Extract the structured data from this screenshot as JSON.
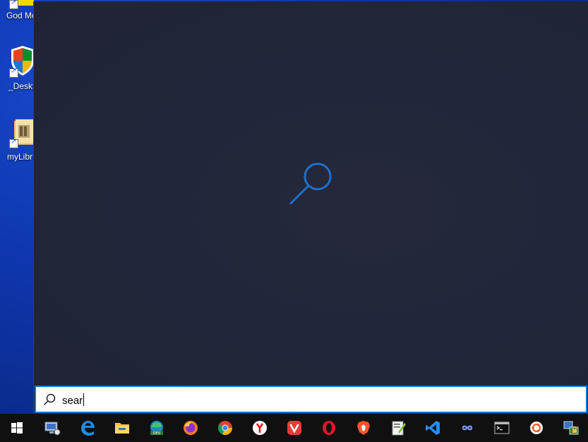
{
  "desktop": {
    "icons": [
      {
        "label": "God Mo",
        "name": "god-mode-shortcut"
      },
      {
        "label": "_Deskt",
        "name": "desktop-shortcut"
      },
      {
        "label": "myLibr",
        "name": "mylibrary-shortcut"
      }
    ]
  },
  "search": {
    "query": "sear",
    "panel_icon": "search-icon"
  },
  "taskbar": {
    "apps": [
      {
        "name": "start-button",
        "icon": "windows-logo-icon"
      },
      {
        "name": "this-pc-app",
        "icon": "computer-icon"
      },
      {
        "name": "edge-legacy-app",
        "icon": "edge-icon"
      },
      {
        "name": "file-explorer-app",
        "icon": "folder-icon"
      },
      {
        "name": "edge-dev-app",
        "icon": "edge-dev-icon"
      },
      {
        "name": "firefox-app",
        "icon": "firefox-icon"
      },
      {
        "name": "chrome-app",
        "icon": "chrome-icon"
      },
      {
        "name": "yandex-app",
        "icon": "yandex-icon"
      },
      {
        "name": "vivaldi-app",
        "icon": "vivaldi-icon"
      },
      {
        "name": "opera-app",
        "icon": "opera-icon"
      },
      {
        "name": "brave-app",
        "icon": "brave-icon"
      },
      {
        "name": "notepadpp-app",
        "icon": "notepad-icon"
      },
      {
        "name": "vscode-app",
        "icon": "vscode-icon"
      },
      {
        "name": "infinity-app",
        "icon": "infinity-icon"
      },
      {
        "name": "terminal-app",
        "icon": "terminal-icon"
      },
      {
        "name": "ubuntu-app",
        "icon": "ubuntu-icon"
      },
      {
        "name": "network-lock-app",
        "icon": "network-lock-icon"
      }
    ]
  },
  "colors": {
    "accent": "#0078d7",
    "panel_bg": "#22263a",
    "taskbar_bg": "#101010"
  }
}
